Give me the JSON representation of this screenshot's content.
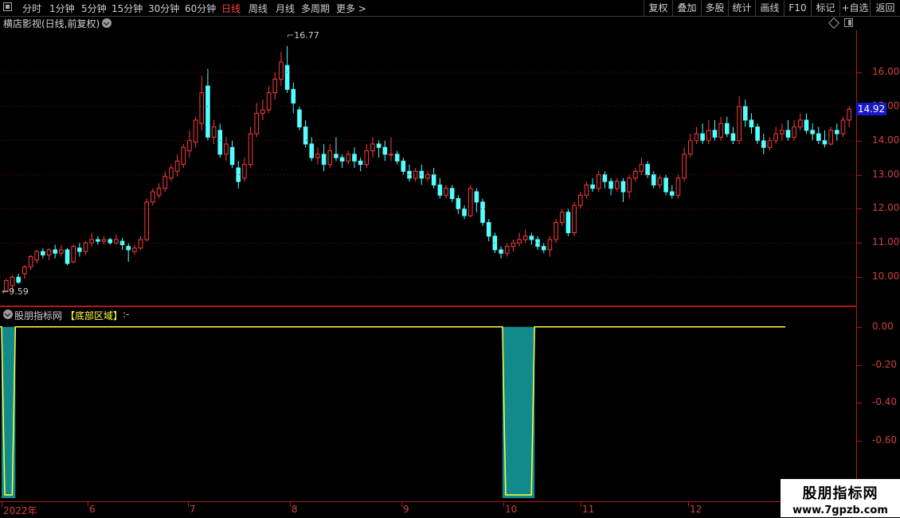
{
  "toolbar": {
    "timeframes": [
      "分时",
      "1分钟",
      "5分钟",
      "15分钟",
      "30分钟",
      "60分钟",
      "日线",
      "周线",
      "月线",
      "多周期",
      "更多"
    ],
    "active": "日线",
    "right_buttons": [
      "复权",
      "叠加",
      "多股",
      "统计",
      "画线",
      "F10",
      "标记",
      "+自选",
      "返回"
    ]
  },
  "title": {
    "stock_name": "横店影视(日线,前复权)",
    "indicator_name": "股朋指标网",
    "indicator_param": "【底部区域】",
    "indicator_value": ":-"
  },
  "price_axis": {
    "labels": [
      "16.00",
      "15.00",
      "14.00",
      "13.00",
      "12.00",
      "11.00",
      "10.00"
    ],
    "last_price": "14.92",
    "high_label": "16.77",
    "low_label": "9.59"
  },
  "sub_axis": {
    "labels": [
      "0.00",
      "-0.20",
      "-0.40",
      "-0.60"
    ]
  },
  "date_axis": {
    "labels": [
      "2022年",
      "6",
      "7",
      "8",
      "9",
      "10",
      "11",
      "12"
    ]
  },
  "watermark": {
    "name": "股朋指标网",
    "url": "www.7gpzb.com"
  },
  "colors": {
    "up": "#ff3b3b",
    "down": "#54ffff",
    "axis": "#b01818",
    "indicator": "#ffff40",
    "fill": "#138a8a"
  },
  "chart_data": {
    "type": "candlestick",
    "ylim": [
      9.4,
      17.0
    ],
    "series_note": "",
    "candles": [
      [
        9.6,
        9.9,
        9.55,
        9.95
      ],
      [
        9.75,
        10.0,
        9.6,
        10.05
      ],
      [
        10.0,
        9.85,
        9.8,
        10.1
      ],
      [
        10.1,
        10.3,
        9.95,
        10.35
      ],
      [
        10.3,
        10.6,
        10.2,
        10.65
      ],
      [
        10.5,
        10.75,
        10.4,
        10.8
      ],
      [
        10.75,
        10.65,
        10.55,
        10.85
      ],
      [
        10.65,
        10.8,
        10.5,
        10.85
      ],
      [
        10.8,
        10.7,
        10.55,
        10.95
      ],
      [
        10.7,
        10.8,
        10.6,
        10.95
      ],
      [
        10.8,
        10.4,
        10.35,
        10.85
      ],
      [
        10.45,
        10.9,
        10.4,
        10.95
      ],
      [
        10.85,
        10.75,
        10.6,
        11.0
      ],
      [
        10.75,
        11.0,
        10.65,
        11.05
      ],
      [
        11.0,
        11.1,
        10.9,
        11.3
      ],
      [
        11.1,
        11.05,
        10.95,
        11.2
      ],
      [
        11.05,
        11.1,
        10.95,
        11.2
      ],
      [
        11.1,
        11.0,
        10.95,
        11.15
      ],
      [
        11.0,
        11.1,
        10.95,
        11.25
      ],
      [
        11.05,
        10.95,
        10.8,
        11.15
      ],
      [
        10.9,
        10.8,
        10.45,
        11.0
      ],
      [
        10.75,
        10.85,
        10.65,
        10.95
      ],
      [
        10.85,
        11.1,
        10.8,
        11.2
      ],
      [
        11.1,
        12.2,
        11.05,
        12.3
      ],
      [
        12.2,
        12.5,
        12.1,
        12.6
      ],
      [
        12.4,
        12.6,
        12.3,
        12.75
      ],
      [
        12.6,
        12.95,
        12.5,
        13.1
      ],
      [
        12.9,
        13.2,
        12.8,
        13.3
      ],
      [
        13.1,
        13.4,
        12.95,
        13.6
      ],
      [
        13.3,
        13.8,
        13.2,
        13.9
      ],
      [
        13.7,
        14.0,
        13.5,
        14.3
      ],
      [
        13.95,
        14.6,
        13.8,
        14.7
      ],
      [
        14.5,
        15.4,
        14.3,
        15.9
      ],
      [
        15.6,
        14.1,
        14.0,
        16.1
      ],
      [
        14.1,
        14.4,
        13.9,
        14.6
      ],
      [
        14.3,
        13.6,
        13.5,
        14.5
      ],
      [
        13.6,
        13.9,
        13.4,
        14.1
      ],
      [
        13.8,
        13.3,
        13.2,
        14.0
      ],
      [
        13.2,
        12.8,
        12.6,
        13.4
      ],
      [
        12.9,
        13.3,
        12.8,
        13.5
      ],
      [
        13.3,
        14.2,
        13.2,
        14.4
      ],
      [
        14.2,
        14.8,
        14.1,
        15.1
      ],
      [
        14.8,
        14.9,
        14.6,
        15.2
      ],
      [
        14.9,
        15.4,
        14.8,
        15.6
      ],
      [
        15.4,
        15.8,
        15.2,
        16.0
      ],
      [
        15.8,
        16.3,
        15.6,
        16.6
      ],
      [
        16.2,
        15.5,
        15.4,
        16.77
      ],
      [
        15.5,
        15.1,
        14.8,
        15.7
      ],
      [
        14.9,
        14.4,
        14.3,
        15.0
      ],
      [
        14.4,
        13.9,
        13.8,
        14.6
      ],
      [
        13.9,
        13.5,
        13.4,
        14.1
      ],
      [
        13.5,
        13.6,
        13.3,
        13.8
      ],
      [
        13.6,
        13.3,
        13.1,
        13.9
      ],
      [
        13.3,
        13.7,
        13.2,
        13.9
      ],
      [
        13.6,
        13.5,
        13.4,
        14.1
      ],
      [
        13.5,
        13.4,
        13.2,
        13.6
      ],
      [
        13.4,
        13.6,
        13.3,
        13.7
      ],
      [
        13.6,
        13.4,
        13.2,
        13.8
      ],
      [
        13.4,
        13.3,
        13.1,
        13.5
      ],
      [
        13.3,
        13.7,
        13.2,
        13.9
      ],
      [
        13.7,
        13.9,
        13.5,
        14.1
      ],
      [
        13.9,
        13.8,
        13.5,
        14.0
      ],
      [
        13.8,
        13.6,
        13.4,
        14.0
      ],
      [
        13.6,
        13.6,
        13.4,
        14.1
      ],
      [
        13.6,
        13.4,
        13.3,
        13.7
      ],
      [
        13.4,
        13.1,
        13.0,
        13.5
      ],
      [
        13.1,
        12.9,
        12.8,
        13.3
      ],
      [
        12.9,
        13.1,
        12.8,
        13.2
      ],
      [
        13.1,
        12.9,
        12.7,
        13.3
      ],
      [
        12.9,
        13.0,
        12.8,
        13.1
      ],
      [
        13.0,
        12.7,
        12.6,
        13.2
      ],
      [
        12.7,
        12.4,
        12.3,
        12.9
      ],
      [
        12.4,
        12.6,
        12.3,
        12.7
      ],
      [
        12.6,
        12.3,
        12.2,
        12.7
      ],
      [
        12.3,
        12.0,
        11.85,
        12.4
      ],
      [
        12.0,
        11.8,
        11.7,
        12.1
      ],
      [
        11.8,
        12.6,
        11.75,
        12.7
      ],
      [
        12.5,
        12.2,
        11.9,
        12.6
      ],
      [
        12.2,
        11.6,
        11.5,
        12.3
      ],
      [
        11.6,
        11.2,
        11.05,
        11.7
      ],
      [
        11.2,
        10.8,
        10.7,
        11.3
      ],
      [
        10.8,
        10.7,
        10.55,
        10.9
      ],
      [
        10.7,
        10.9,
        10.6,
        11.0
      ],
      [
        10.9,
        11.0,
        10.75,
        11.1
      ],
      [
        11.0,
        11.1,
        10.9,
        11.3
      ],
      [
        11.1,
        11.2,
        11.0,
        11.4
      ],
      [
        11.2,
        11.1,
        10.95,
        11.3
      ],
      [
        11.1,
        10.9,
        10.8,
        11.2
      ],
      [
        10.9,
        10.8,
        10.7,
        11.0
      ],
      [
        10.8,
        11.1,
        10.6,
        11.2
      ],
      [
        11.1,
        11.6,
        11.0,
        11.7
      ],
      [
        11.6,
        11.9,
        11.5,
        12.0
      ],
      [
        11.9,
        11.3,
        11.2,
        12.0
      ],
      [
        11.3,
        12.1,
        11.2,
        12.2
      ],
      [
        12.1,
        12.4,
        12.0,
        12.5
      ],
      [
        12.4,
        12.7,
        12.3,
        12.8
      ],
      [
        12.7,
        12.6,
        12.5,
        12.9
      ],
      [
        12.6,
        13.0,
        12.5,
        13.1
      ],
      [
        13.0,
        12.8,
        12.6,
        13.1
      ],
      [
        12.8,
        12.6,
        12.4,
        12.9
      ],
      [
        12.6,
        12.8,
        12.5,
        12.9
      ],
      [
        12.8,
        12.5,
        12.2,
        12.9
      ],
      [
        12.5,
        12.9,
        12.3,
        13.0
      ],
      [
        12.9,
        13.1,
        12.8,
        13.2
      ],
      [
        13.1,
        13.3,
        13.0,
        13.5
      ],
      [
        13.3,
        13.0,
        12.9,
        13.4
      ],
      [
        13.0,
        12.7,
        12.6,
        13.1
      ],
      [
        12.7,
        12.9,
        12.6,
        13.0
      ],
      [
        12.9,
        12.5,
        12.4,
        13.0
      ],
      [
        12.5,
        12.4,
        12.3,
        12.7
      ],
      [
        12.4,
        12.9,
        12.3,
        13.0
      ],
      [
        12.9,
        13.6,
        12.8,
        13.8
      ],
      [
        13.6,
        14.0,
        13.5,
        14.2
      ],
      [
        14.0,
        14.2,
        13.9,
        14.4
      ],
      [
        14.2,
        14.0,
        13.9,
        14.5
      ],
      [
        14.0,
        14.3,
        13.9,
        14.6
      ],
      [
        14.3,
        14.1,
        14.0,
        14.6
      ],
      [
        14.1,
        14.5,
        14.0,
        14.7
      ],
      [
        14.5,
        14.2,
        14.1,
        14.7
      ],
      [
        14.2,
        14.0,
        13.9,
        14.4
      ],
      [
        14.0,
        15.0,
        13.9,
        15.3
      ],
      [
        15.0,
        14.6,
        14.4,
        15.2
      ],
      [
        14.6,
        14.4,
        14.2,
        14.8
      ],
      [
        14.4,
        14.0,
        13.9,
        14.5
      ],
      [
        14.0,
        13.8,
        13.6,
        14.2
      ],
      [
        13.8,
        14.0,
        13.7,
        14.1
      ],
      [
        14.0,
        14.2,
        13.9,
        14.4
      ],
      [
        14.2,
        14.3,
        14.0,
        14.5
      ],
      [
        14.3,
        14.1,
        14.0,
        14.6
      ],
      [
        14.1,
        14.4,
        14.0,
        14.6
      ],
      [
        14.4,
        14.6,
        14.3,
        14.8
      ],
      [
        14.6,
        14.3,
        14.2,
        14.8
      ],
      [
        14.3,
        14.2,
        14.0,
        14.5
      ],
      [
        14.2,
        14.0,
        13.9,
        14.4
      ],
      [
        14.0,
        13.9,
        13.8,
        14.3
      ],
      [
        13.9,
        14.3,
        13.85,
        14.4
      ],
      [
        14.3,
        14.2,
        14.0,
        14.5
      ],
      [
        14.2,
        14.6,
        14.1,
        14.7
      ],
      [
        14.6,
        14.92,
        14.4,
        15.0
      ]
    ],
    "sub_series": {
      "ylim": [
        -0.9,
        0.02
      ],
      "signal_index_ranges": [
        [
          0,
          1
        ],
        [
          82,
          86
        ]
      ]
    }
  }
}
